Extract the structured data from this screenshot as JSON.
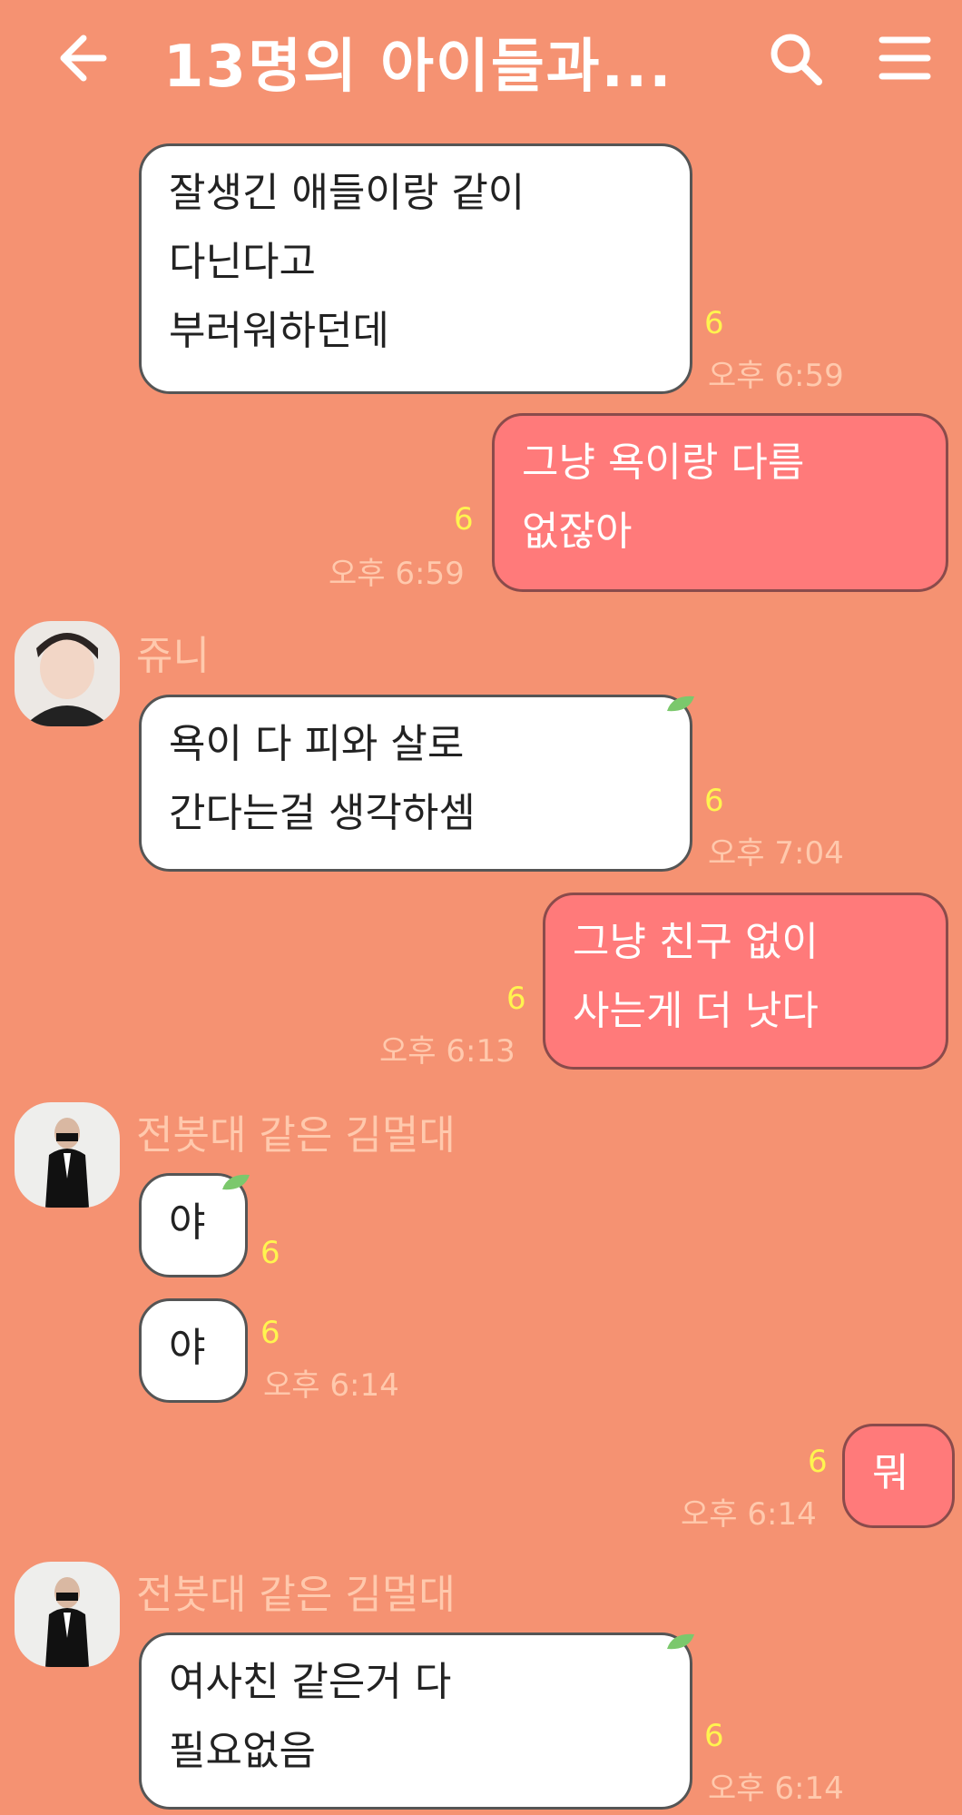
{
  "header": {
    "title": "13명의 아이들과...",
    "back_icon": "back-arrow-icon",
    "search_icon": "search-icon",
    "menu_icon": "menu-icon"
  },
  "messages": [
    {
      "sender": "",
      "lines": [
        "잘생긴 애들이랑 같이",
        "다닌다고",
        "부러워하던데"
      ],
      "unread": "6",
      "time": "오후 6:59"
    },
    {
      "sender": "me",
      "lines": [
        "그냥 욕이랑 다름",
        "없잖아"
      ],
      "unread": "6",
      "time": "오후 6:59"
    },
    {
      "sender": "쥬니",
      "lines": [
        "욕이 다 피와 살로",
        "간다는걸 생각하셈"
      ],
      "unread": "6",
      "time": "오후 7:04"
    },
    {
      "sender": "me",
      "lines": [
        "그냥 친구 없이",
        "사는게 더 낫다"
      ],
      "unread": "6",
      "time": "오후 6:13"
    },
    {
      "sender": "전봇대 같은 김멀대",
      "lines": [
        "야"
      ],
      "unread": "6",
      "time": ""
    },
    {
      "sender": "",
      "lines": [
        "야"
      ],
      "unread": "6",
      "time": "오후 6:14"
    },
    {
      "sender": "me",
      "lines": [
        "뭐"
      ],
      "unread": "6",
      "time": "오후 6:14"
    },
    {
      "sender": "전봇대 같은 김멀대",
      "lines": [
        "여사친 같은거 다",
        "필요없음"
      ],
      "unread": "6",
      "time": "오후 6:14"
    }
  ],
  "colors": {
    "background": "#f59272",
    "my_bubble": "#ff7a7a",
    "other_bubble": "#ffffff",
    "unread": "#fff44f"
  }
}
